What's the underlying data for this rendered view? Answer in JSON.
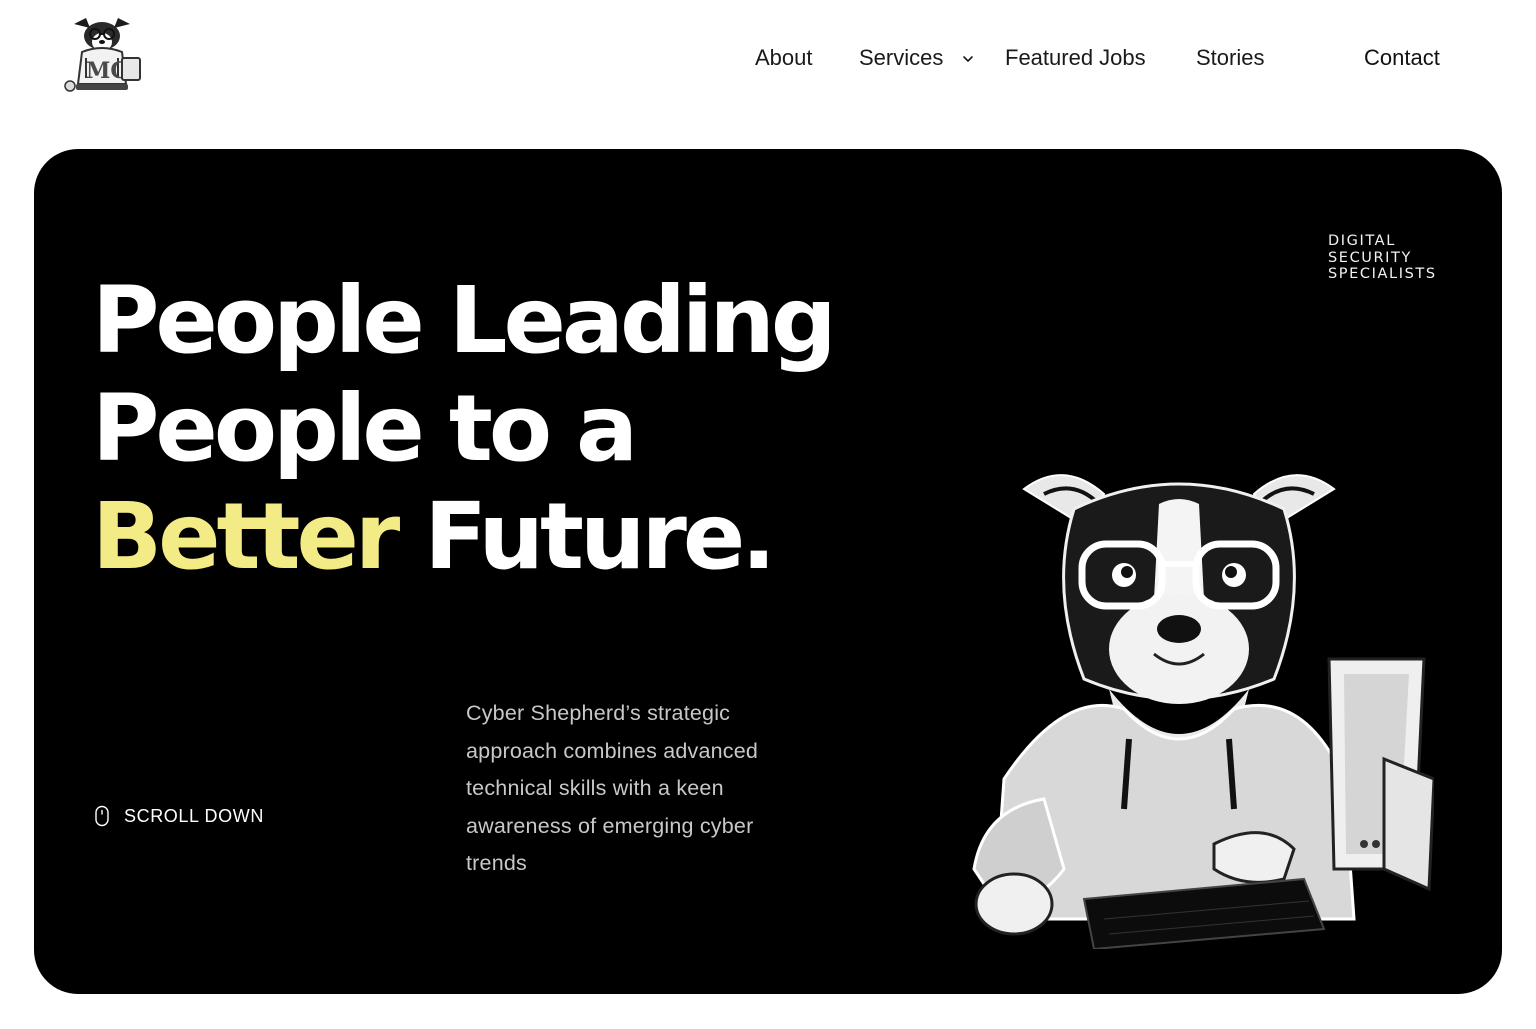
{
  "header": {
    "logo_icon": "shepherd-dog-logo-icon",
    "nav": {
      "about": "About",
      "services": "Services",
      "featured_jobs": "Featured Jobs",
      "stories": "Stories",
      "contact": "Contact"
    }
  },
  "hero": {
    "tagline": [
      "DIGITAL",
      "SECURITY",
      "SPECIALISTS"
    ],
    "headline": {
      "line1": "People Leading",
      "line2": "People to a",
      "accent_word": "Better",
      "line3_rest": " Future."
    },
    "accent_color": "#f3ec86",
    "background_color": "#000000",
    "scroll_label": "SCROLL DOWN",
    "scroll_icon": "mouse-icon",
    "description": "Cyber Shepherd’s strategic approach combines advanced technical skills with a keen awareness of emerging cyber trends",
    "mascot_icon": "dog-with-glasses-at-computer-illustration"
  }
}
